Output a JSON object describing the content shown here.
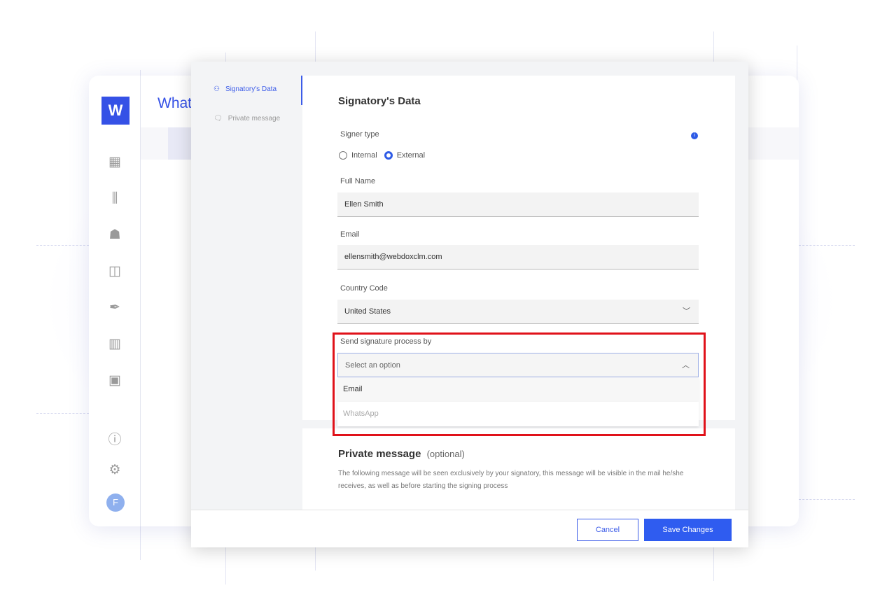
{
  "app": {
    "logo_letter": "W",
    "page_title": "What",
    "avatar_initial": "F"
  },
  "sidebar_icons": [
    "dashboard-icon",
    "library-icon",
    "contacts-icon",
    "modules-icon",
    "signature-icon",
    "reports-icon",
    "inbox-icon",
    "help-icon",
    "gear-icon"
  ],
  "modal": {
    "nav": [
      {
        "label": "Signatory's Data",
        "active": true
      },
      {
        "label": "Private message",
        "active": false
      }
    ],
    "section_title": "Signatory's Data",
    "signer_type": {
      "label": "Signer type",
      "options": [
        "Internal",
        "External"
      ],
      "selected": "External"
    },
    "full_name": {
      "label": "Full Name",
      "value": "Ellen Smith"
    },
    "email": {
      "label": "Email",
      "value": "ellensmith@webdoxclm.com"
    },
    "country_code": {
      "label": "Country Code",
      "value": "United States"
    },
    "send_by": {
      "label": "Send signature process by",
      "placeholder": "Select an option",
      "options": [
        "Email",
        "WhatsApp"
      ]
    },
    "private_message": {
      "title": "Private message",
      "optional": "(optional)",
      "description": "The following message will be seen exclusively by your signatory, this message will be visible in the mail he/she receives, as well as before starting the signing process"
    },
    "cancel_label": "Cancel",
    "save_label": "Save Changes"
  },
  "colors": {
    "accent": "#2f5cf0",
    "highlight": "#e0121a"
  }
}
